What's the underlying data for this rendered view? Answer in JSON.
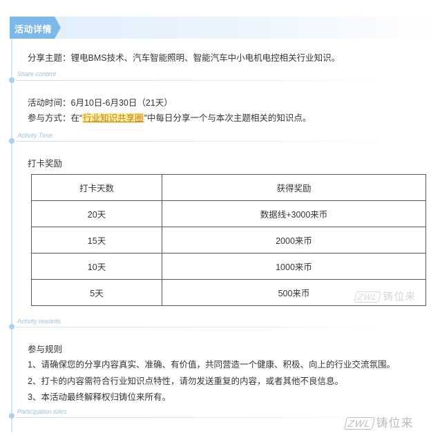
{
  "header": {
    "title": "活动详情"
  },
  "sections": {
    "share": {
      "label": "Share content",
      "line1": "分享主题：锂电BMS技术、汽车智能照明、智能汽车中小电机电控相关行业知识。"
    },
    "time": {
      "label": "Activity Time",
      "line1": "活动时间：6月10日-6月30日（21天）",
      "line2_prefix": "参与方式：在“",
      "line2_highlight": "行业知识共享圈",
      "line2_suffix": "”中每日分享一个与本次主题相关的知识点。"
    },
    "rewards": {
      "label": "Activity rewards",
      "title": "打卡奖励",
      "columns": [
        "打卡天数",
        "获得奖励"
      ],
      "rows": [
        [
          "20天",
          "数据线+3000来币"
        ],
        [
          "15天",
          "2000来币"
        ],
        [
          "10天",
          "1000来币"
        ],
        [
          "5天",
          "500来币"
        ]
      ]
    },
    "rules": {
      "label": "Participation rules",
      "title": "参与规则",
      "items": [
        "1、请确保您的分享内容真实、准确、有价值，共同营造一个健康、积极、向上的行业交流氛围。",
        "2、打卡的内容需符合行业知识点特性，请勿发送重复的内容，或者其他不良信息。",
        "3、本活动最终解释权归铸位来所有。"
      ]
    }
  },
  "watermark": {
    "logo": "ZWL",
    "text": "铸位来"
  }
}
